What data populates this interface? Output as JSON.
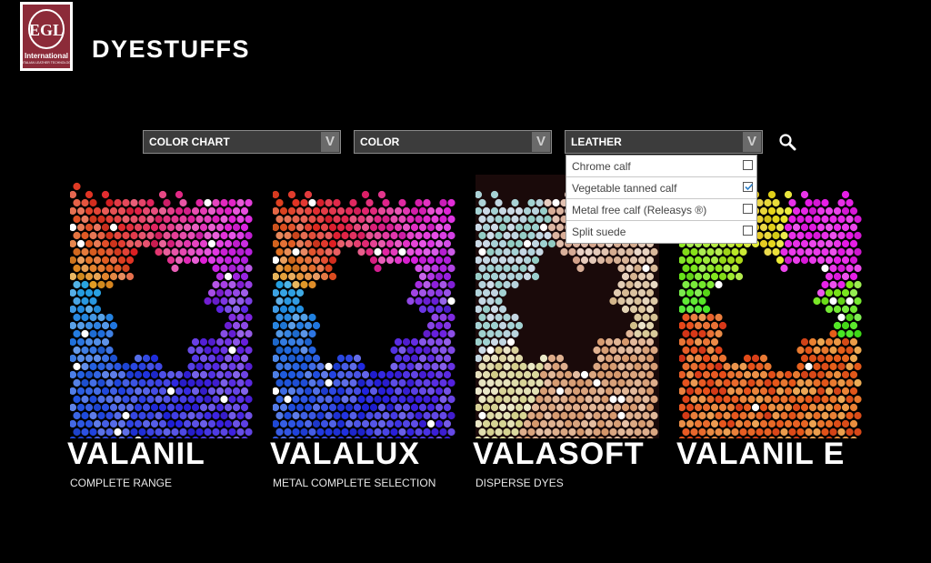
{
  "brand": {
    "logo_text": "EGL",
    "logo_name": "International",
    "logo_tagline": "ITALIAN LEATHER TECHNOLOGY",
    "color": "#8c2b39"
  },
  "page_title": "DYESTUFFS",
  "filters": [
    {
      "label": "COLOR CHART",
      "arrow": "V"
    },
    {
      "label": "COLOR",
      "arrow": "V"
    },
    {
      "label": "LEATHER",
      "arrow": "V",
      "expanded": true
    }
  ],
  "search_icon": "search-icon",
  "leather_options": [
    {
      "label": "Chrome calf",
      "checked": false
    },
    {
      "label": "Vegetable tanned calf",
      "checked": true
    },
    {
      "label": "Metal free calf (Releasys ®)",
      "checked": false
    },
    {
      "label": "Split suede",
      "checked": false
    }
  ],
  "products": [
    {
      "name": "VALANIL",
      "subtitle": "COMPLETE RANGE",
      "palette": "rainbow"
    },
    {
      "name": "VALALUX",
      "subtitle": "METAL COMPLETE SELECTION",
      "palette": "rainbow"
    },
    {
      "name": "VALASOFT",
      "subtitle": "DISPERSE DYES",
      "palette": "pastel"
    },
    {
      "name": "VALANIL E",
      "subtitle": "",
      "palette": "vivid"
    }
  ]
}
